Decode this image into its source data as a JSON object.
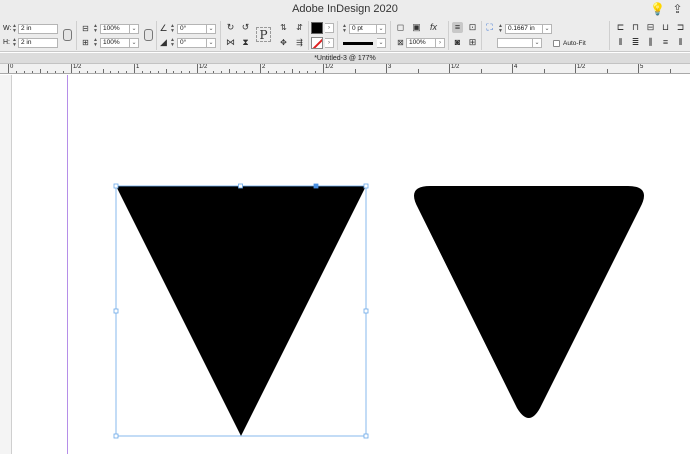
{
  "window": {
    "title": "Adobe InDesign 2020",
    "lightbulb_icon": "lightbulb-icon",
    "share_icon": "share-icon"
  },
  "control_panel": {
    "w_label": "W:",
    "w_value": "2 in",
    "h_label": "H:",
    "h_value": "2 in",
    "scale_x": "100%",
    "scale_y": "100%",
    "rotation_angle": "0°",
    "shear_angle": "0°",
    "stroke_weight": "0 pt",
    "opacity": "100%",
    "corner_size": "0.1667 in",
    "autofit_label": "Auto-Fit",
    "fill_color": "#000000",
    "stroke_color": "none"
  },
  "document_tab": {
    "title": "*Untitled-3 @ 177%"
  },
  "ruler": {
    "labels": [
      "0",
      "1/2",
      "1",
      "1/2",
      "2",
      "1/2",
      "3",
      "1/2",
      "4",
      "1/2",
      "5"
    ]
  },
  "canvas": {
    "shapes": [
      {
        "name": "sharp-triangle",
        "fill": "#000000",
        "selected": true
      },
      {
        "name": "rounded-triangle",
        "fill": "#000000",
        "selected": false
      }
    ],
    "selection_color": "#4a90e2",
    "margin_guide_color": "#b58ee8"
  }
}
